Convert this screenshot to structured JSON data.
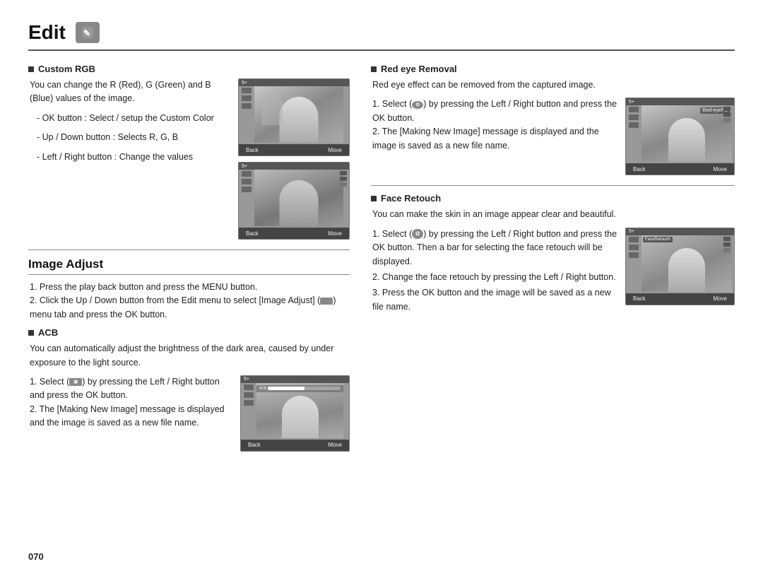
{
  "header": {
    "title": "Edit",
    "icon_label": "edit-icon"
  },
  "left_col": {
    "custom_rgb": {
      "title": "Custom RGB",
      "description": "You can change the R (Red), G (Green) and B (Blue) values of the image.",
      "instructions": [
        "- OK button : Select / setup the Custom Color",
        "- Up / Down button : Selects R, G, B",
        "- Left / Right button : Change the values"
      ]
    },
    "image_adjust": {
      "heading": "Image Adjust",
      "steps": [
        "1. Press the play back button and press the MENU button.",
        "2. Click the Up / Down button from the Edit menu to select [Image Adjust] (      ) menu tab and press the OK button."
      ],
      "acb": {
        "title": "ACB",
        "description": "You can automatically adjust the brightness of the dark area, caused by under exposure to the light source.",
        "steps": [
          "1. Select (     ) by pressing the Left / Right button and press the OK button.",
          "2. The [Making New Image] message is displayed and the image is saved as a new file name."
        ]
      }
    }
  },
  "right_col": {
    "red_eye": {
      "title": "Red eye Removal",
      "description": "Red eye effect can be removed from the captured image.",
      "steps": [
        "1. Select (     ) by pressing the Left / Right button and press the OK button.",
        "2. The [Making New Image] message is displayed and the image is saved as a new file name."
      ]
    },
    "face_retouch": {
      "title": "Face Retouch",
      "description": "You can make the skin in an image appear clear and beautiful.",
      "steps": [
        "1. Select (     ) by pressing the Left / Right button and press the OK button. Then a bar for selecting the face retouch will be displayed.",
        "2. Change the face retouch by pressing the Left / Right button.",
        "3. Press the OK button and the image will be saved as a new file name."
      ]
    }
  },
  "camera_labels": {
    "back": "Back",
    "move": "Move"
  },
  "page_number": "070"
}
